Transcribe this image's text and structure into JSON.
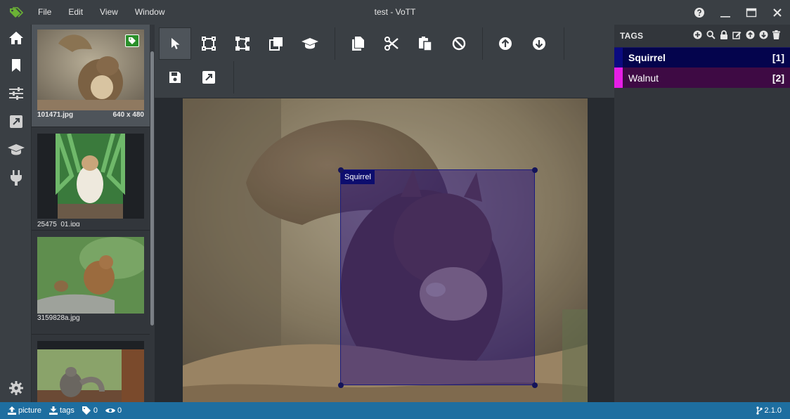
{
  "app": {
    "title": "test - VoTT"
  },
  "menu": [
    "File",
    "Edit",
    "View",
    "Window"
  ],
  "window_controls": [
    "help-icon",
    "minimize-icon",
    "maximize-icon",
    "close-icon"
  ],
  "nav": [
    {
      "icon": "home-icon"
    },
    {
      "icon": "bookmark-icon",
      "active": true
    },
    {
      "icon": "sliders-icon"
    },
    {
      "icon": "export-icon"
    },
    {
      "icon": "graduation-cap-icon"
    },
    {
      "icon": "plug-icon"
    }
  ],
  "nav_settings_icon": "gear-icon",
  "thumbnails": [
    {
      "name": "101471.jpg",
      "size": "640 x 480",
      "tagged": true,
      "active": true
    },
    {
      "name": "25475_01.jpg",
      "size": "",
      "tagged": false
    },
    {
      "name": "3159828a.jpg",
      "size": "",
      "tagged": false
    },
    {
      "name": "",
      "size": "",
      "tagged": false
    }
  ],
  "toolbar": {
    "row1": [
      "pointer-icon",
      "rectangle-icon",
      "polygon-icon",
      "copy-rectangle-icon",
      "active-learning-icon",
      "copy-icon",
      "cut-icon",
      "paste-icon",
      "clear-icon",
      "previous-asset-icon",
      "next-asset-icon"
    ],
    "row2": [
      "save-icon",
      "export-icon"
    ]
  },
  "region": {
    "tag": "Squirrel",
    "color": "#1a1a80"
  },
  "tags_panel": {
    "title": "TAGS",
    "actions": [
      "add-icon",
      "search-icon",
      "lock-icon",
      "edit-icon",
      "move-up-icon",
      "move-down-icon",
      "delete-icon"
    ],
    "tags": [
      {
        "name": "Squirrel",
        "hotkey": "[1]",
        "color": "#0b0b80",
        "bg": "#04044d",
        "selected": true
      },
      {
        "name": "Walnut",
        "hotkey": "[2]",
        "color": "#e61ee6",
        "bg": "#3e0a44",
        "selected": false
      }
    ]
  },
  "status": {
    "items": [
      {
        "icon": "upload-icon",
        "label": "picture"
      },
      {
        "icon": "download-icon",
        "label": "tags"
      },
      {
        "icon": "tag-icon",
        "label": "0"
      },
      {
        "icon": "eye-icon",
        "label": "0"
      }
    ],
    "version": "2.1.0"
  }
}
